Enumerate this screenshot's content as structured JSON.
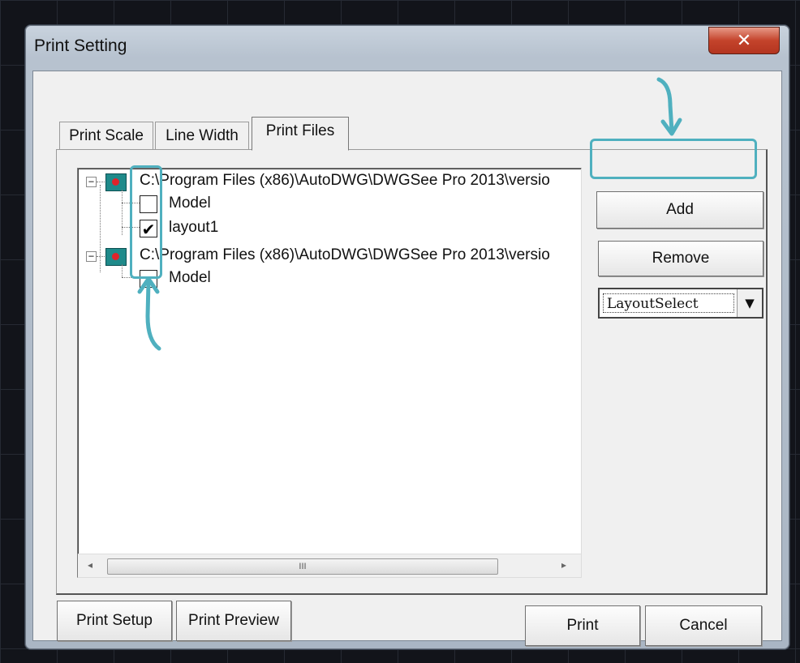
{
  "window": {
    "title": "Print Setting",
    "close_glyph": "✕"
  },
  "tabs": [
    {
      "label": "Print Scale",
      "active": false
    },
    {
      "label": "Line Width",
      "active": false
    },
    {
      "label": "Print Files",
      "active": true
    }
  ],
  "tree": {
    "files": [
      {
        "path": "C:\\Program Files (x86)\\AutoDWG\\DWGSee Pro 2013\\versio",
        "expander": "−",
        "icon": "dwg-file-icon",
        "layouts": [
          {
            "label": "Model",
            "checked": false
          },
          {
            "label": "layout1",
            "checked": true
          }
        ]
      },
      {
        "path": "C:\\Program Files (x86)\\AutoDWG\\DWGSee Pro 2013\\versio",
        "expander": "−",
        "icon": "dwg-file-icon",
        "layouts": [
          {
            "label": "Model",
            "checked": false
          }
        ]
      }
    ],
    "scroll": {
      "left_arrow": "◂",
      "right_arrow": "▸",
      "thumb_grip": "III"
    }
  },
  "side_buttons": {
    "add": "Add",
    "remove": "Remove"
  },
  "layout_select": {
    "value": "LayoutSelect",
    "arrow": "▼"
  },
  "footer_buttons": {
    "print_setup": "Print Setup",
    "print_preview": "Print Preview",
    "print": "Print",
    "cancel": "Cancel"
  },
  "colors": {
    "annotation": "#4fb0bf",
    "close_button": "#c4432b",
    "file_icon": "#1f8a8a"
  }
}
